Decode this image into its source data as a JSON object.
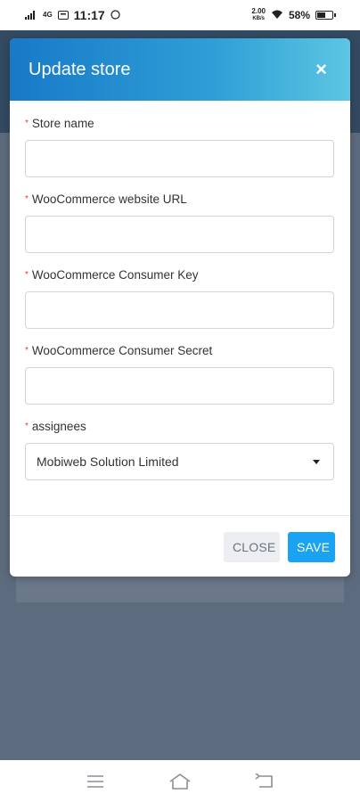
{
  "status_bar": {
    "network": "4G",
    "time": "11:17",
    "speed": "2.00",
    "speed_unit": "KB/s",
    "battery": "58%",
    "battery_level": 0.58
  },
  "modal": {
    "title": "Update store",
    "close_icon": "×",
    "fields": [
      {
        "label": "Store name",
        "value": "",
        "placeholder": ""
      },
      {
        "label": "WooCommerce website URL",
        "value": "",
        "placeholder": ""
      },
      {
        "label": "WooCommerce Consumer Key",
        "value": "",
        "placeholder": ""
      },
      {
        "label": "WooCommerce Consumer Secret",
        "value": "",
        "placeholder": ""
      }
    ],
    "assignees": {
      "label": "assignees",
      "selected": "Mobiweb Solution Limited"
    },
    "required_marker": "*",
    "buttons": {
      "close": "CLOSE",
      "save": "SAVE"
    }
  },
  "colors": {
    "header_gradient_start": "#1879c8",
    "header_gradient_end": "#5cc6e3",
    "save_button": "#1aa3f2",
    "required_marker": "#e23b3b",
    "overlay": "#5d6b7e"
  },
  "nav_bar": {
    "icons": [
      "menu-icon",
      "home-icon",
      "back-icon"
    ]
  }
}
